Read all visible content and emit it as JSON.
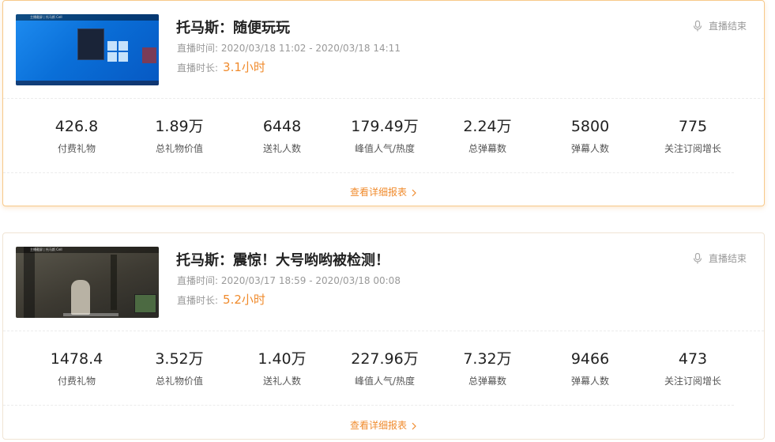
{
  "theme": {
    "accent": "#f08b2d",
    "active_border": "#f7c98a"
  },
  "labels": {
    "time_prefix": "直播时间:",
    "duration_prefix": "直播时长:",
    "report_link": "查看详细报表",
    "stat_labels": [
      "付费礼物",
      "总礼物价值",
      "送礼人数",
      "峰值人气/热度",
      "总弹幕数",
      "弹幕人数",
      "关注订阅增长"
    ]
  },
  "sessions": [
    {
      "title": "托马斯：随便玩玩",
      "time_range": "2020/03/18 11:02 - 2020/03/18 14:11",
      "duration": "3.1小时",
      "status": "直播结束",
      "thumbnail_caption": "主播截屏 | 托马斯 Cell",
      "stats": [
        "426.8",
        "1.89万",
        "6448",
        "179.49万",
        "2.24万",
        "5800",
        "775"
      ]
    },
    {
      "title": "托马斯：震惊！大号哟哟被检测！",
      "time_range": "2020/03/17 18:59 - 2020/03/18 00:08",
      "duration": "5.2小时",
      "status": "直播结束",
      "thumbnail_caption": "主播截屏 | 托马斯 Cell",
      "stats": [
        "1478.4",
        "3.52万",
        "1.40万",
        "227.96万",
        "7.32万",
        "9466",
        "473"
      ]
    }
  ]
}
